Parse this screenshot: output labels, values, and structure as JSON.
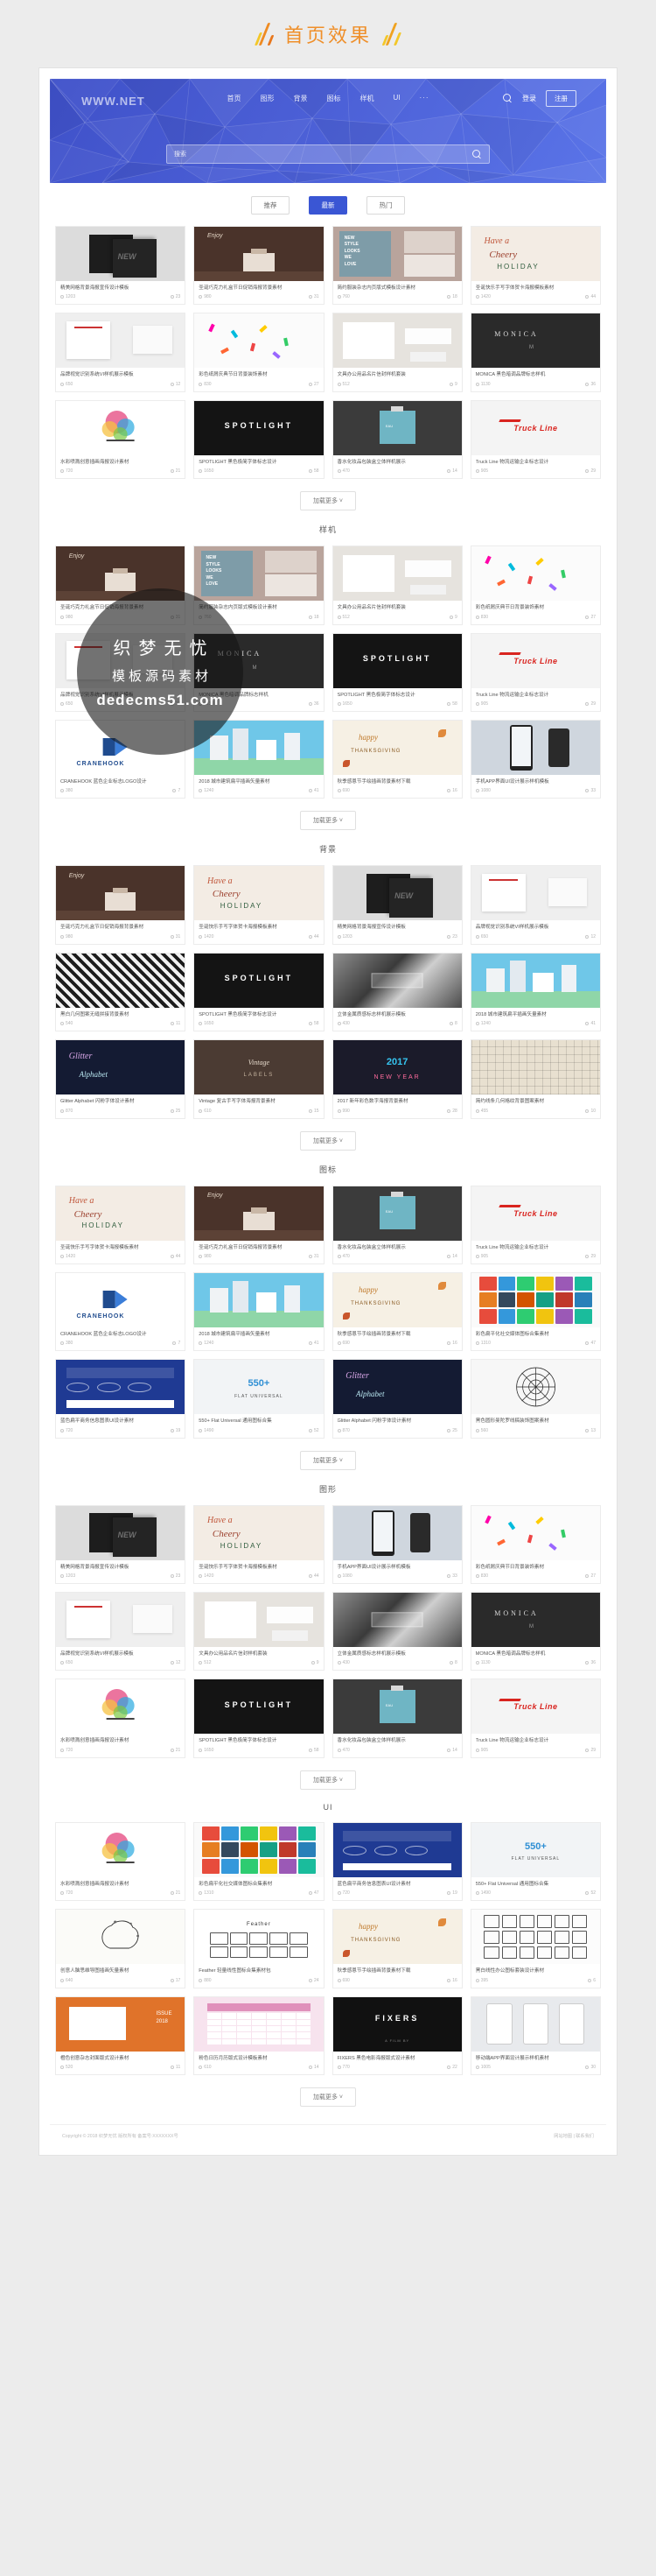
{
  "page": {
    "title": "首页效果",
    "decoration_icon": "slash-decoration-icon"
  },
  "site_header": {
    "logo": "WWW.NET",
    "nav_items": [
      "首页",
      "图形",
      "背景",
      "图标",
      "样机",
      "UI"
    ],
    "nav_overflow": "···",
    "search_icon": "search-icon",
    "login_label": "登录",
    "register_label": "注册",
    "hero_search_placeholder": "搜索",
    "hero_search_icon": "search-icon"
  },
  "tabs": [
    {
      "label": "推荐",
      "active": false
    },
    {
      "label": "最新",
      "active": true
    },
    {
      "label": "热门",
      "active": false
    }
  ],
  "load_more_label": "加载更多",
  "load_more_icon": "chevron-down-icon",
  "watermark": {
    "line1": "织梦无忧",
    "line2": "模板源码素材",
    "line3": "dedecms51.com"
  },
  "footer": {
    "copyright": "Copyright © 2018 织梦无忧 版权所有  备案号:XXXXXXX号",
    "links": "网站地图 | 联系我们"
  },
  "sections": [
    {
      "title": "",
      "items": [
        {
          "name": "精美网格背景海报宣传设计模板",
          "views": "1203",
          "likes": "23",
          "style": "dark-poster"
        },
        {
          "name": "圣诞巧克力礼盒节日促销海报背景素材",
          "views": "980",
          "likes": "31",
          "style": "choco"
        },
        {
          "name": "简约服装杂志内页版式模板设计素材",
          "views": "760",
          "likes": "18",
          "style": "fashion"
        },
        {
          "name": "圣诞快乐手写字体贺卡海报模板素材",
          "views": "1420",
          "likes": "44",
          "style": "xmas-card"
        },
        {
          "name": "品牌视觉识别系统VI样机展示模板",
          "views": "650",
          "likes": "12",
          "style": "vi-mock"
        },
        {
          "name": "彩色纸屑庆典节日背景装饰素材",
          "views": "830",
          "likes": "27",
          "style": "confetti"
        },
        {
          "name": "文具办公用品名片信封样机套装",
          "views": "512",
          "likes": "9",
          "style": "stationery"
        },
        {
          "name": "MONICA 黑色暗调品牌标志样机",
          "views": "1130",
          "likes": "36",
          "style": "monica"
        },
        {
          "name": "水彩喷溅创意插画海报设计素材",
          "views": "720",
          "likes": "21",
          "style": "splash"
        },
        {
          "name": "SPOTLIGHT 黑色极简字体标志设计",
          "views": "1650",
          "likes": "58",
          "style": "spotlight"
        },
        {
          "name": "香水化妆品包装盒立体样机展示",
          "views": "470",
          "likes": "14",
          "style": "perfume"
        },
        {
          "name": "Truck Line 物流运输企业标志设计",
          "views": "905",
          "likes": "29",
          "style": "truck"
        }
      ]
    },
    {
      "title": "样机",
      "items": [
        {
          "name": "圣诞巧克力礼盒节日促销海报背景素材",
          "views": "980",
          "likes": "31",
          "style": "choco"
        },
        {
          "name": "简约服装杂志内页版式模板设计素材",
          "views": "760",
          "likes": "18",
          "style": "fashion"
        },
        {
          "name": "文具办公用品名片信封样机套装",
          "views": "512",
          "likes": "9",
          "style": "stationery"
        },
        {
          "name": "彩色纸屑庆典节日背景装饰素材",
          "views": "830",
          "likes": "27",
          "style": "confetti"
        },
        {
          "name": "品牌视觉识别系统VI样机展示模板",
          "views": "650",
          "likes": "12",
          "style": "vi-mock"
        },
        {
          "name": "MONICA 黑色暗调品牌标志样机",
          "views": "1130",
          "likes": "36",
          "style": "monica"
        },
        {
          "name": "SPOTLIGHT 黑色极简字体标志设计",
          "views": "1650",
          "likes": "58",
          "style": "spotlight"
        },
        {
          "name": "Truck Line 物流运输企业标志设计",
          "views": "905",
          "likes": "29",
          "style": "truck"
        },
        {
          "name": "CRANEHOOK 蓝色企业标志LOGO设计",
          "views": "380",
          "likes": "7",
          "style": "cranehook"
        },
        {
          "name": "2018 城市建筑扁平插画矢量素材",
          "views": "1240",
          "likes": "41",
          "style": "city"
        },
        {
          "name": "秋季感恩节手绘插画背景素材下载",
          "views": "690",
          "likes": "16",
          "style": "autumn"
        },
        {
          "name": "手机APP界面UI设计展示样机模板",
          "views": "1080",
          "likes": "33",
          "style": "appui"
        }
      ]
    },
    {
      "title": "背景",
      "items": [
        {
          "name": "圣诞巧克力礼盒节日促销海报背景素材",
          "views": "980",
          "likes": "31",
          "style": "choco"
        },
        {
          "name": "圣诞快乐手写字体贺卡海报模板素材",
          "views": "1420",
          "likes": "44",
          "style": "xmas-card"
        },
        {
          "name": "精美网格背景海报宣传设计模板",
          "views": "1203",
          "likes": "23",
          "style": "dark-poster"
        },
        {
          "name": "品牌视觉识别系统VI样机展示模板",
          "views": "650",
          "likes": "12",
          "style": "vi-mock"
        },
        {
          "name": "黑白几何图案无缝拼接背景素材",
          "views": "540",
          "likes": "11",
          "style": "pattern"
        },
        {
          "name": "SPOTLIGHT 黑色极简字体标志设计",
          "views": "1650",
          "likes": "58",
          "style": "spotlight"
        },
        {
          "name": "立体金属质感标志样机展示模板",
          "views": "430",
          "likes": "8",
          "style": "metal"
        },
        {
          "name": "2018 城市建筑扁平插画矢量素材",
          "views": "1240",
          "likes": "41",
          "style": "city"
        },
        {
          "name": "Glitter Alphabet 闪粉字体设计素材",
          "views": "870",
          "likes": "25",
          "style": "glitter"
        },
        {
          "name": "Vintage 复古手写字体海报背景素材",
          "views": "610",
          "likes": "15",
          "style": "vintage"
        },
        {
          "name": "2017 新年彩色数字海报背景素材",
          "views": "990",
          "likes": "28",
          "style": "newyear"
        },
        {
          "name": "简约线条几何格纹背景图案素材",
          "views": "455",
          "likes": "10",
          "style": "lines"
        }
      ]
    },
    {
      "title": "图标",
      "items": [
        {
          "name": "圣诞快乐手写字体贺卡海报模板素材",
          "views": "1420",
          "likes": "44",
          "style": "xmas-card"
        },
        {
          "name": "圣诞巧克力礼盒节日促销海报背景素材",
          "views": "980",
          "likes": "31",
          "style": "choco"
        },
        {
          "name": "香水化妆品包装盒立体样机展示",
          "views": "470",
          "likes": "14",
          "style": "perfume"
        },
        {
          "name": "Truck Line 物流运输企业标志设计",
          "views": "905",
          "likes": "29",
          "style": "truck"
        },
        {
          "name": "CRANEHOOK 蓝色企业标志LOGO设计",
          "views": "380",
          "likes": "7",
          "style": "cranehook"
        },
        {
          "name": "2018 城市建筑扁平插画矢量素材",
          "views": "1240",
          "likes": "41",
          "style": "city"
        },
        {
          "name": "秋季感恩节手绘插画背景素材下载",
          "views": "690",
          "likes": "16",
          "style": "autumn"
        },
        {
          "name": "彩色扁平化社交媒体图标合集素材",
          "views": "1310",
          "likes": "47",
          "style": "icons"
        },
        {
          "name": "蓝色扁平商务信息图表UI设计素材",
          "views": "720",
          "likes": "19",
          "style": "infographic"
        },
        {
          "name": "550+ Flat Universal 通用图标合集",
          "views": "1490",
          "likes": "52",
          "style": "flat550"
        },
        {
          "name": "Glitter Alphabet 闪粉字体设计素材",
          "views": "870",
          "likes": "25",
          "style": "glitter"
        },
        {
          "name": "黑色圆形曼陀罗线稿装饰图案素材",
          "views": "560",
          "likes": "13",
          "style": "mandala"
        }
      ]
    },
    {
      "title": "图形",
      "items": [
        {
          "name": "精美网格背景海报宣传设计模板",
          "views": "1203",
          "likes": "23",
          "style": "dark-poster"
        },
        {
          "name": "圣诞快乐手写字体贺卡海报模板素材",
          "views": "1420",
          "likes": "44",
          "style": "xmas-card"
        },
        {
          "name": "手机APP界面UI设计展示样机模板",
          "views": "1080",
          "likes": "33",
          "style": "appui"
        },
        {
          "name": "彩色纸屑庆典节日背景装饰素材",
          "views": "830",
          "likes": "27",
          "style": "confetti"
        },
        {
          "name": "品牌视觉识别系统VI样机展示模板",
          "views": "650",
          "likes": "12",
          "style": "vi-mock"
        },
        {
          "name": "文具办公用品名片信封样机套装",
          "views": "512",
          "likes": "9",
          "style": "stationery"
        },
        {
          "name": "立体金属质感标志样机展示模板",
          "views": "430",
          "likes": "8",
          "style": "metal"
        },
        {
          "name": "MONICA 黑色暗调品牌标志样机",
          "views": "1130",
          "likes": "36",
          "style": "monica"
        },
        {
          "name": "水彩喷溅创意插画海报设计素材",
          "views": "720",
          "likes": "21",
          "style": "splash"
        },
        {
          "name": "SPOTLIGHT 黑色极简字体标志设计",
          "views": "1650",
          "likes": "58",
          "style": "spotlight"
        },
        {
          "name": "香水化妆品包装盒立体样机展示",
          "views": "470",
          "likes": "14",
          "style": "perfume"
        },
        {
          "name": "Truck Line 物流运输企业标志设计",
          "views": "905",
          "likes": "29",
          "style": "truck"
        }
      ]
    },
    {
      "title": "UI",
      "items": [
        {
          "name": "水彩喷溅创意插画海报设计素材",
          "views": "720",
          "likes": "21",
          "style": "splash"
        },
        {
          "name": "彩色扁平化社交媒体图标合集素材",
          "views": "1310",
          "likes": "47",
          "style": "icons"
        },
        {
          "name": "蓝色扁平商务信息图表UI设计素材",
          "views": "720",
          "likes": "19",
          "style": "infographic"
        },
        {
          "name": "550+ Flat Universal 通用图标合集",
          "views": "1490",
          "likes": "52",
          "style": "flat550"
        },
        {
          "name": "创意人脑思维导图插画矢量素材",
          "views": "640",
          "likes": "17",
          "style": "brain"
        },
        {
          "name": "Feather 轻量线性图标合集素材包",
          "views": "880",
          "likes": "24",
          "style": "feather"
        },
        {
          "name": "秋季感恩节手绘插画背景素材下载",
          "views": "690",
          "likes": "16",
          "style": "autumn"
        },
        {
          "name": "黑白线性办公图标套装设计素材",
          "views": "395",
          "likes": "6",
          "style": "lineicons"
        },
        {
          "name": "橙色创意杂志封面版式设计素材",
          "views": "520",
          "likes": "11",
          "style": "orangemag"
        },
        {
          "name": "粉色日历月历版式设计模板素材",
          "views": "610",
          "likes": "14",
          "style": "calendar"
        },
        {
          "name": "FIXERS 黑色电影海报版式设计素材",
          "views": "770",
          "likes": "22",
          "style": "fixers"
        },
        {
          "name": "移动端APP界面设计展示样机素材",
          "views": "1005",
          "likes": "30",
          "style": "mobileapp"
        }
      ]
    }
  ]
}
